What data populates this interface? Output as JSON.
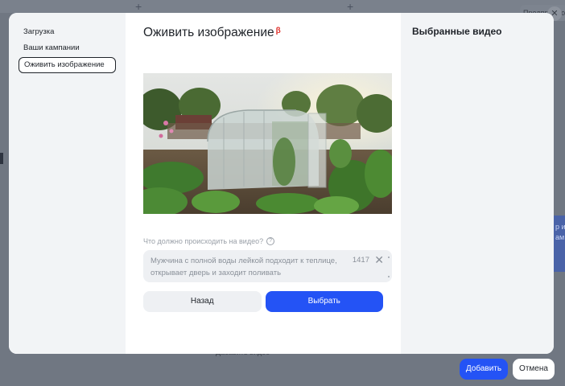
{
  "background": {
    "top_tab_label": "Предпросмотр",
    "banner_text": "р из ам",
    "bottom_text": "Дабавить видео"
  },
  "nav": {
    "items": [
      {
        "label": "Загрузка"
      },
      {
        "label": "Ваши кампании"
      },
      {
        "label": "Оживить изображение"
      }
    ]
  },
  "center": {
    "title": "Оживить изображение",
    "beta_badge": "β",
    "preview_alt": "greenhouse-garden-photo",
    "prompt_label": "Что должно происходить на видео?",
    "prompt_value": "Мужчина с полной воды лейкой подходит к теплице, открывает дверь и заходит поливать",
    "char_count": "1417",
    "back_label": "Назад",
    "choose_label": "Выбрать"
  },
  "right": {
    "title": "Выбранные видео"
  },
  "footer": {
    "add_label": "Добавить",
    "cancel_label": "Отмена"
  },
  "colors": {
    "accent": "#2453f5",
    "beta": "#e0332d",
    "panel": "#f2f4f6"
  }
}
